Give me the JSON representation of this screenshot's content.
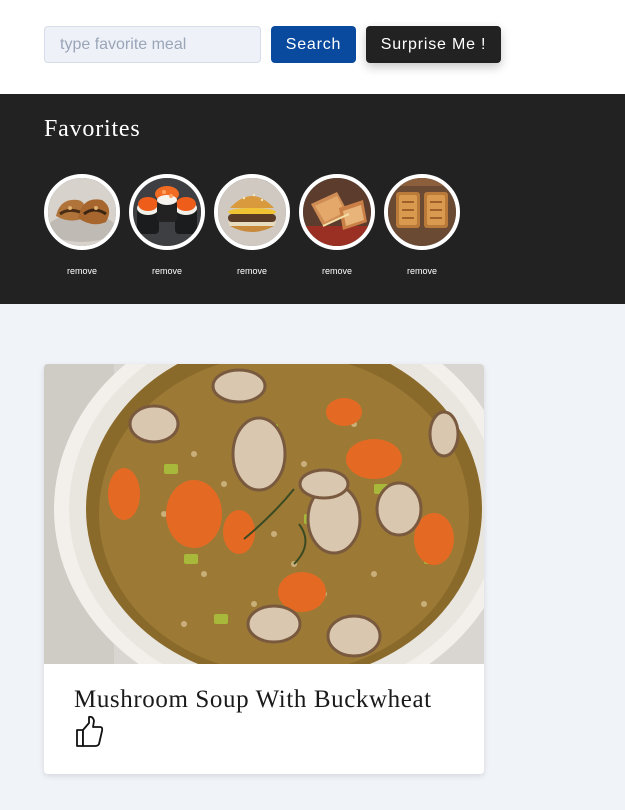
{
  "search": {
    "placeholder": "type favorite meal",
    "value": "",
    "search_label": "Search",
    "surprise_label": "Surprise Me !"
  },
  "favorites": {
    "title": "Favorites",
    "items": [
      {
        "icon": "stuffed-flatbread-thumbnail",
        "remove_label": "remove"
      },
      {
        "icon": "sushi-roll-thumbnail",
        "remove_label": "remove"
      },
      {
        "icon": "burger-thumbnail",
        "remove_label": "remove"
      },
      {
        "icon": "grilled-sandwich-thumbnail",
        "remove_label": "remove"
      },
      {
        "icon": "toasted-sandwich-thumbnail",
        "remove_label": "remove"
      }
    ]
  },
  "meal": {
    "title": "Mushroom Soup With Buckwheat",
    "image": "mushroom-soup-photo",
    "like_icon": "thumbs-up-icon"
  },
  "colors": {
    "primary": "#0a4a9e",
    "dark": "#222222",
    "page_bg": "#f0f3f8"
  }
}
